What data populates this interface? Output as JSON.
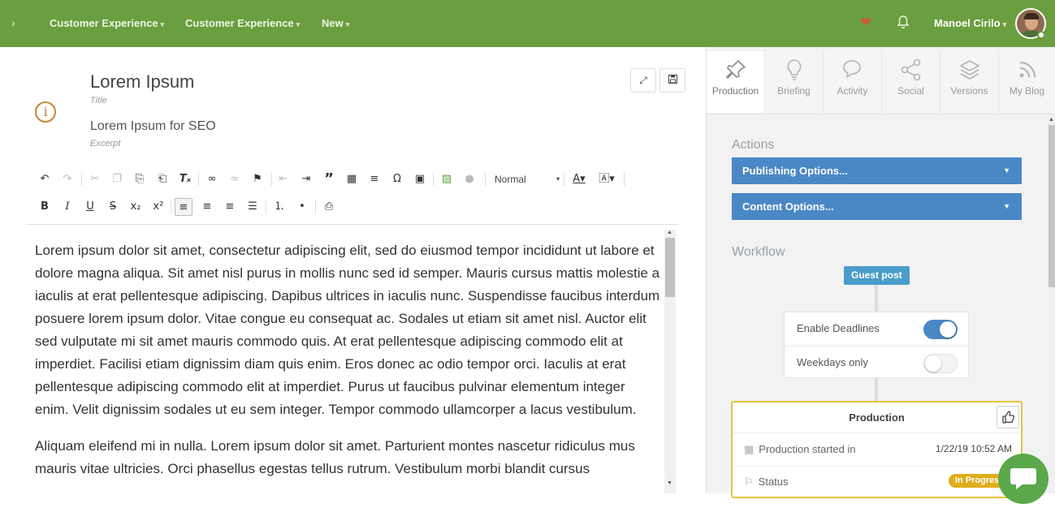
{
  "topbar": {
    "menus": [
      "Customer Experience",
      "Customer Experience",
      "New"
    ],
    "user": "Manoel Cirilo"
  },
  "editor": {
    "title": "Lorem Ipsum",
    "title_label": "Title",
    "excerpt": "Lorem Ipsum for SEO",
    "excerpt_label": "Excerpt",
    "format_select": "Normal",
    "paragraphs": [
      "Lorem ipsum dolor sit amet, consectetur adipiscing elit, sed do eiusmod tempor incididunt ut labore et dolore magna aliqua. Sit amet nisl purus in mollis nunc sed id semper. Mauris cursus mattis molestie a iaculis at erat pellentesque adipiscing. Dapibus ultrices in iaculis nunc. Suspendisse faucibus interdum posuere lorem ipsum dolor. Vitae congue eu consequat ac. Sodales ut etiam sit amet nisl. Auctor elit sed vulputate mi sit amet mauris commodo quis. At erat pellentesque adipiscing commodo elit at imperdiet. Facilisi etiam dignissim diam quis enim. Eros donec ac odio tempor orci. Iaculis at erat pellentesque adipiscing commodo elit at imperdiet. Purus ut faucibus pulvinar elementum integer enim. Velit dignissim sodales ut eu sem integer. Tempor commodo ullamcorper a lacus vestibulum.",
      "Aliquam eleifend mi in nulla. Lorem ipsum dolor sit amet. Parturient montes nascetur ridiculus mus mauris vitae ultricies. Orci phasellus egestas tellus rutrum. Vestibulum morbi blandit cursus"
    ]
  },
  "panel": {
    "tabs": [
      "Production",
      "Briefing",
      "Activity",
      "Social",
      "Versions",
      "My Blog"
    ],
    "actions_title": "Actions",
    "publishing_options": "Publishing Options...",
    "content_options": "Content Options...",
    "workflow_title": "Workflow",
    "guest_post": "Guest post",
    "enable_deadlines": "Enable Deadlines",
    "weekdays_only": "Weekdays only",
    "production": {
      "title": "Production",
      "started_label": "Production started in",
      "started_value": "1/22/19 10:52 AM",
      "status_label": "Status",
      "status_value": "In Progress"
    }
  },
  "colors": {
    "topbar": "#6a9e3f",
    "accent_blue": "#4a88c5",
    "guest_badge": "#4a9dc9",
    "card_border": "#e4c43e",
    "status": "#e0ad1b"
  }
}
